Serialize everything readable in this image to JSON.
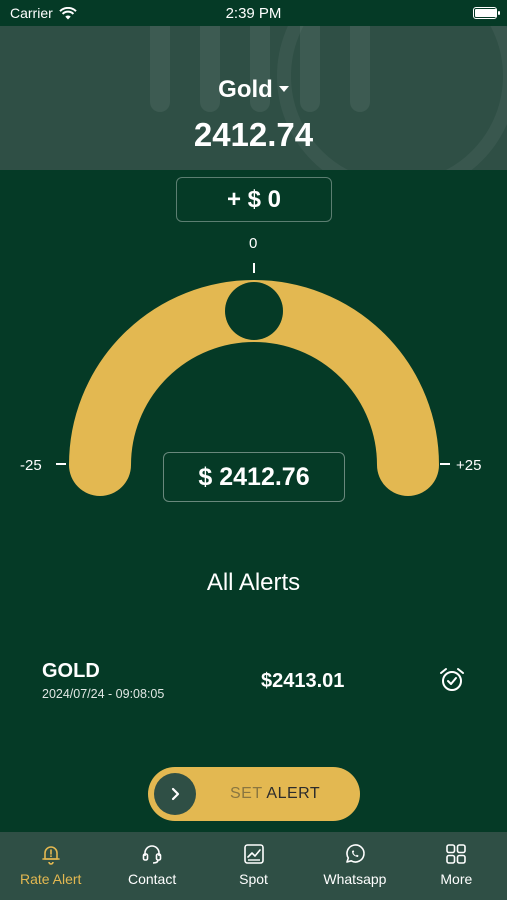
{
  "status_bar": {
    "carrier": "Carrier",
    "time": "2:39 PM",
    "wifi_icon": "wifi-icon",
    "battery_icon": "battery-icon"
  },
  "header": {
    "metal": "Gold",
    "metal_dropdown_icon": "caret-down-icon",
    "price": "2412.74"
  },
  "adjuster": {
    "delta_label": "+ $ 0",
    "scale_top": "0",
    "scale_min": "-25",
    "scale_max": "+25",
    "offset_value": 0,
    "target_price": "$ 2412.76"
  },
  "alerts": {
    "title": "All Alerts",
    "items": [
      {
        "name": "GOLD",
        "datetime": "2024/07/24 - 09:08:05",
        "price": "$2413.01",
        "icon": "alarm-check-icon"
      }
    ]
  },
  "set_alert": {
    "label_dim": "SET",
    "label": " ALERT",
    "icon": "chevron-right-icon"
  },
  "tabbar": {
    "items": [
      {
        "label": "Rate Alert",
        "icon": "bell-alert-icon",
        "active": true
      },
      {
        "label": "Contact",
        "icon": "headset-icon",
        "active": false
      },
      {
        "label": "Spot",
        "icon": "chart-frame-icon",
        "active": false
      },
      {
        "label": "Whatsapp",
        "icon": "whatsapp-icon",
        "active": false
      },
      {
        "label": "More",
        "icon": "grid-icon",
        "active": false
      }
    ]
  },
  "colors": {
    "background": "#053a26",
    "header": "#2f4f45",
    "accent": "#e3b851"
  }
}
